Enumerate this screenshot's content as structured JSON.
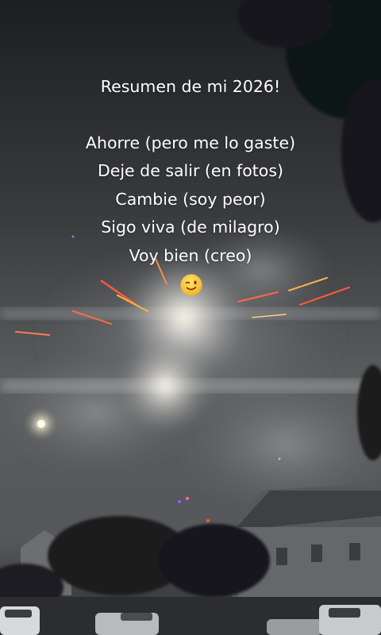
{
  "caption": {
    "title": "Resumen de mi 2026!",
    "lines": [
      "Ahorre (pero me lo gaste)",
      "Deje de salir (en fotos)",
      "Cambie (soy peor)",
      "Sigo viva (de milagro)",
      "Voy bien (creo)"
    ],
    "emoji_name": "winking-face-emoji"
  },
  "scene": {
    "description_icon": "fireworks-night-photo",
    "colors": {
      "sky_top": "#202224",
      "sky_mid": "#4a4c4e",
      "smoke": "#8f9193",
      "glow": "#fff7e6",
      "spark_red": "#ff5a3c",
      "spark_orange": "#ffb347",
      "trees": "#14181a",
      "house": "#6d6f72",
      "ground": "#2a2c2e"
    }
  }
}
